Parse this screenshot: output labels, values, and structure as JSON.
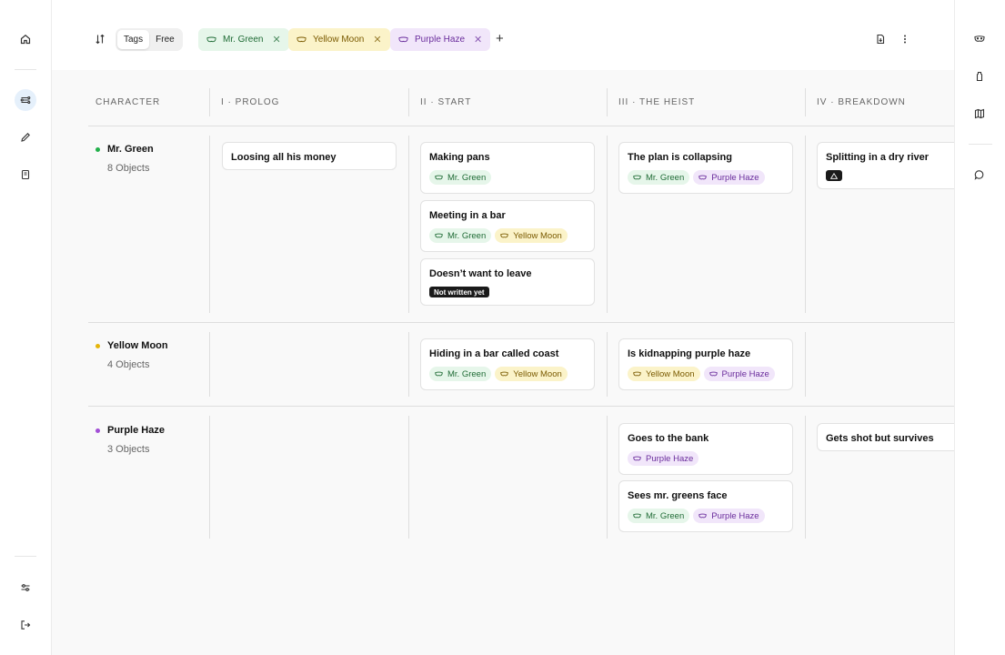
{
  "toolbar": {
    "modes": [
      "Tags",
      "Free"
    ],
    "active_mode": "Tags",
    "filters": [
      {
        "label": "Mr. Green",
        "color": "green"
      },
      {
        "label": "Yellow Moon",
        "color": "yellow"
      },
      {
        "label": "Purple Haze",
        "color": "purple"
      }
    ],
    "add_symbol": "+"
  },
  "columns": {
    "character": "CHARACTER",
    "acts": [
      "I · PROLOG",
      "II · START",
      "III · THE HEIST",
      "IV · BREAKDOWN"
    ]
  },
  "characters": [
    {
      "name": "Mr. Green",
      "count": "8 Objects",
      "dot_color": "#22b04b"
    },
    {
      "name": "Yellow Moon",
      "count": "4 Objects",
      "dot_color": "#e5b50a"
    },
    {
      "name": "Purple Haze",
      "count": "3 Objects",
      "dot_color": "#a24fd6"
    }
  ],
  "cards": {
    "c1": {
      "title": "Loosing all his money"
    },
    "c2": {
      "title": "Making pans",
      "tags": [
        "Mr. Green"
      ]
    },
    "c3": {
      "title": "Meeting in a bar",
      "tags": [
        "Mr. Green",
        "Yellow Moon"
      ]
    },
    "c4": {
      "title": "Doesn’t want to leave",
      "badge": "Not written yet"
    },
    "c5": {
      "title": "The plan is collapsing",
      "tags": [
        "Mr. Green",
        "Purple Haze"
      ]
    },
    "c6": {
      "title": "Splitting in a dry river"
    },
    "c7": {
      "title": "Hiding in a bar called coast",
      "tags": [
        "Mr. Green",
        "Yellow Moon"
      ]
    },
    "c8": {
      "title": "Is kidnapping purple haze",
      "tags": [
        "Yellow Moon",
        "Purple Haze"
      ]
    },
    "c9": {
      "title": "Goes to the bank",
      "tags": [
        "Purple Haze"
      ]
    },
    "c10": {
      "title": "Sees mr. greens face",
      "tags": [
        "Mr. Green",
        "Purple Haze"
      ]
    },
    "c11": {
      "title": "Gets shot but survives"
    }
  },
  "colors": {
    "green_tag_bg": "#e6f6ea",
    "yellow_tag_bg": "#fbf3c9",
    "purple_tag_bg": "#f1e6fa",
    "active_nav_bg": "#e5f0fb"
  },
  "icons": {
    "left_rail": [
      "home-icon",
      "board-icon",
      "pencil-icon",
      "book-icon",
      "settings-sliders-icon",
      "logout-icon"
    ],
    "right_rail": [
      "mask-icon",
      "bottle-icon",
      "map-icon",
      "chat-icon"
    ],
    "toolbar": [
      "sort-icon",
      "export-icon",
      "more-icon"
    ]
  }
}
